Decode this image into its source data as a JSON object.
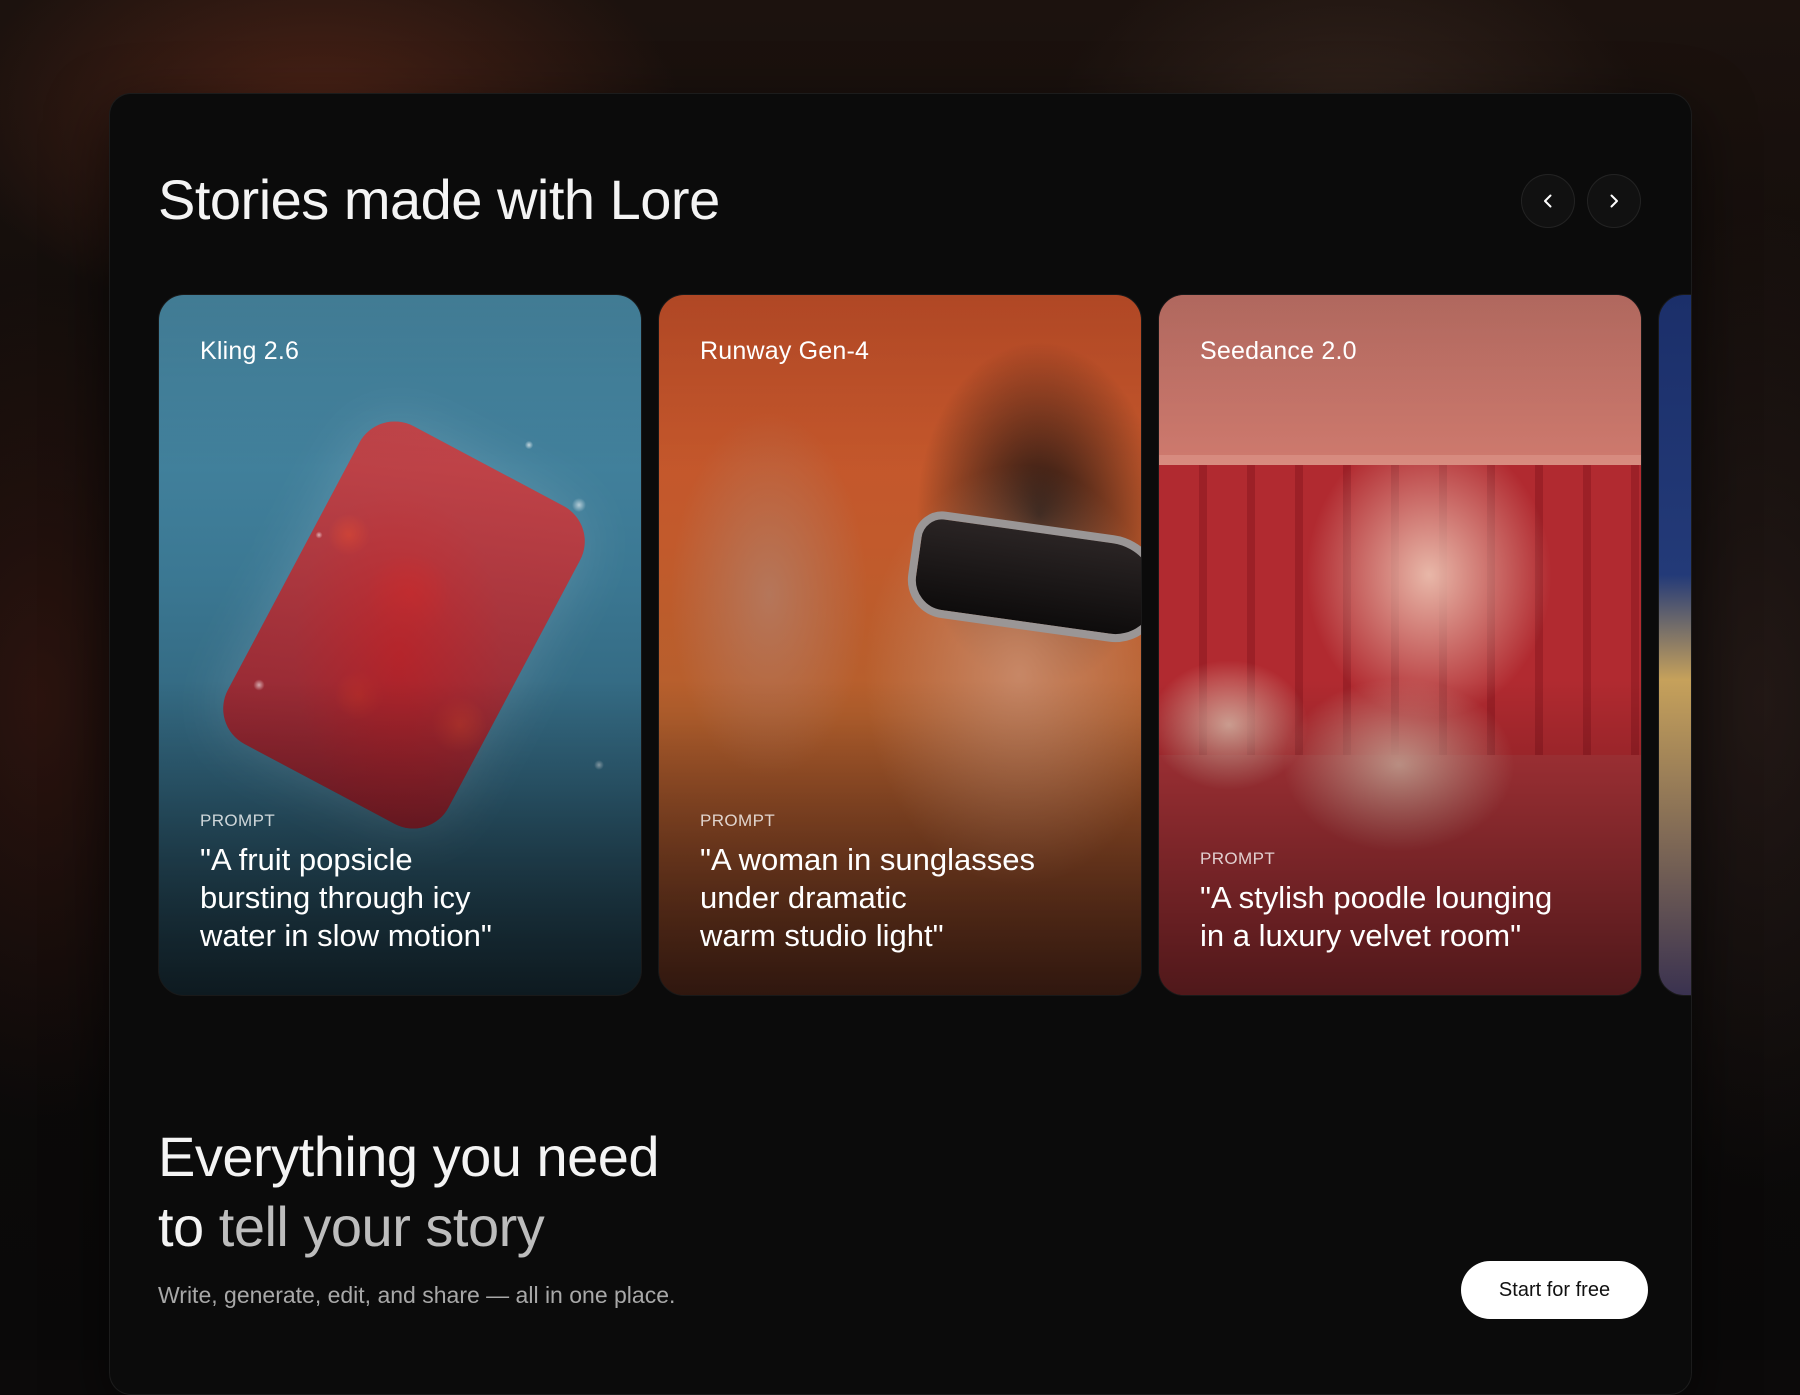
{
  "stories": {
    "title": "Stories made with Lore",
    "nav": {
      "prev_icon": "chevron-left-icon",
      "next_icon": "chevron-right-icon"
    },
    "cards": [
      {
        "model": "Kling 2.6",
        "prompt_label": "PROMPT",
        "prompt": "\"A fruit popsicle\nbursting through icy\nwater in slow motion\""
      },
      {
        "model": "Runway Gen-4",
        "prompt_label": "PROMPT",
        "prompt": "\"A woman in sunglasses\nunder dramatic\nwarm studio light\""
      },
      {
        "model": "Seedance 2.0",
        "prompt_label": "PROMPT",
        "prompt": "\"A stylish poodle lounging\nin a luxury velvet room\""
      }
    ]
  },
  "feature": {
    "headline_line1": "Everything you need",
    "headline_to": "to ",
    "headline_highlight": "tell your story",
    "subtext": "Write, generate, edit, and share — all in one place.",
    "cta_label": "Start for free"
  }
}
